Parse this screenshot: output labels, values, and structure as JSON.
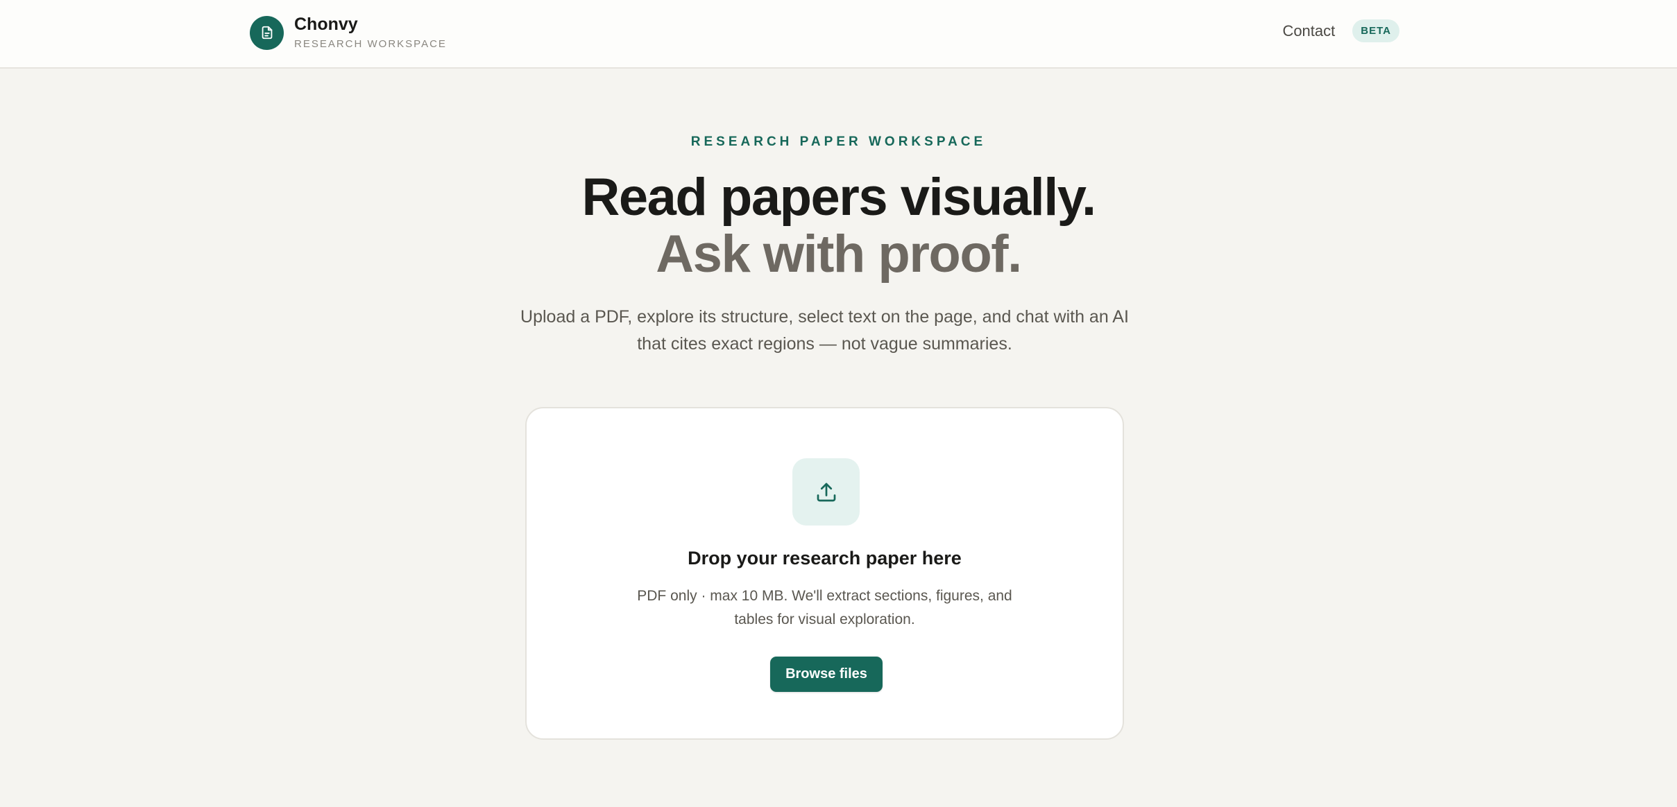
{
  "header": {
    "brand_name": "Chonvy",
    "brand_subtitle": "RESEARCH WORKSPACE",
    "brand_icon": "document-icon",
    "nav_contact": "Contact",
    "badge": "BETA"
  },
  "hero": {
    "eyebrow": "RESEARCH PAPER WORKSPACE",
    "headline_line1": "Read papers visually.",
    "headline_line2": "Ask with proof.",
    "subtitle": "Upload a PDF, explore its structure, select text on the page, and chat with an AI that cites exact regions — not vague summaries."
  },
  "upload": {
    "icon": "upload-icon",
    "title": "Drop your research paper here",
    "description": "PDF only · max 10 MB. We'll extract sections, figures, and tables for visual exploration.",
    "browse_label": "Browse files"
  },
  "colors": {
    "accent": "#17685a",
    "background": "#f5f4f0",
    "badge_bg": "#dff0ec"
  }
}
